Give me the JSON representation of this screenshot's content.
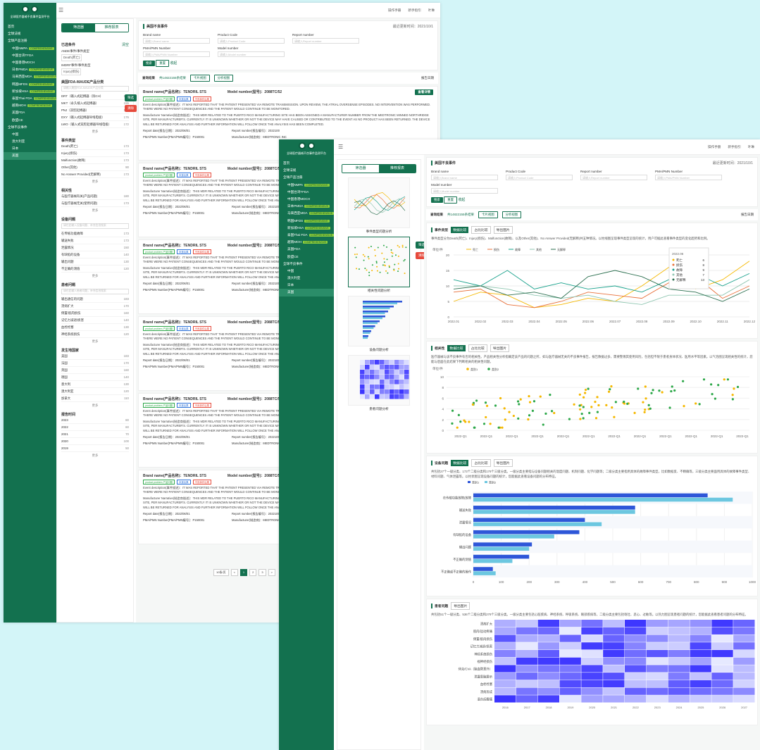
{
  "app": {
    "title": "全球医疗器械不良事件监测平台",
    "menu": [
      "首页",
      "全球法规",
      "全球产品注册",
      "中国NMPA",
      "中国台湾TFDA",
      "中国香港MDCH",
      "日本PMDA",
      "马来西亚MDA",
      "韩国MFDS",
      "新加坡HSA",
      "泰国Thai FDA",
      "越南MOH",
      "美国FDA",
      "欧盟CE",
      "全球不良事件",
      "中国",
      "澳大利亚",
      "日本",
      "美国"
    ],
    "badge": "COMPREHENSIVE"
  },
  "header": {
    "manual": "操作手册",
    "help": "新手指引",
    "user": "叶琳"
  },
  "filter": {
    "tab_list": "筛选器",
    "tab_report": "推荐报表",
    "tab_chart": "筛选器",
    "tab_chart2": "推荐报表",
    "selected": "已选条件",
    "clear": "清空",
    "g1": "ANDE事件/事件类型",
    "g1chip": "Death(死亡)",
    "g2": "IMDRF事件/事件类型",
    "g2chip": "Injury(损伤)",
    "fda_title": "美国FDA-MAUDE产品分类",
    "fda_ph": "请输入美国FDA-MAUDE产品分类",
    "fda_rows": [
      [
        "DRT（输入式起搏器（除CH）",
        173
      ],
      [
        "MKT（永久植入式起搏器）",
        155
      ],
      [
        "PNJ（双腔起搏器）",
        120
      ],
      [
        "DXY（输入式起搏器导线电极）",
        176
      ],
      [
        "LWO（输入式双腔起搏器导线电极）",
        172
      ]
    ],
    "more": "更多",
    "evt_title": "事件类型",
    "evt_rows": [
      [
        "Death(死亡)",
        173
      ],
      [
        "Injury(损伤)",
        173
      ],
      [
        "Malfunction(故障)",
        173
      ],
      [
        "Other(其他)",
        90
      ],
      [
        "No Answer Provided(无解释)",
        173
      ]
    ],
    "rel_title": "相关性",
    "rel_rows": [
      [
        "与医疗器械有关(产品问题)",
        180
      ],
      [
        "与医疗器械无关(使用问题)",
        173
      ]
    ],
    "dev_title": "设备问题",
    "dev_ph": "请在此输入设备问题、补充信息搜索",
    "dev_rows": [
      [
        "在传植功能故障",
        "173"
      ],
      [
        "输送失败",
        173
      ],
      [
        "泄露情况",
        150
      ],
      [
        "有缺陷的设备",
        140
      ],
      [
        "输出问题",
        130
      ],
      [
        "不正确的测值",
        120
      ]
    ],
    "pat_title": "患者问题",
    "pat_ph": "请在此输入患者问题，补充信息搜索",
    "pat_rows": [
      [
        "输出通信的问题",
        183
      ],
      [
        "溃疡扩大",
        170
      ],
      [
        "倒置/肌肉损伤",
        160
      ],
      [
        "记忆力减退/损害",
        140
      ],
      [
        "血栓栓塞",
        130
      ],
      [
        "神经系统损伤",
        120
      ]
    ],
    "area_title": "发生地国家",
    "area_rows": [
      [
        "美国",
        183
      ],
      [
        "法国",
        170
      ],
      [
        "英国",
        160
      ],
      [
        "德国",
        140
      ],
      [
        "意大利",
        130
      ],
      [
        "澳大利亚",
        120
      ],
      [
        "加拿大",
        110
      ]
    ],
    "year_title": "报告时间",
    "year_rows": [
      [
        "2023",
        80
      ],
      [
        "2022",
        60
      ],
      [
        "2021",
        70
      ],
      [
        "2020",
        100
      ],
      [
        "2019",
        50
      ]
    ]
  },
  "search": {
    "title": "美国不良事件",
    "sub": "数据来源：2019年至2023年",
    "updated": "最近更新时间：2021/10/1",
    "f1": "Brand name",
    "f2": "Product Code",
    "f3": "Report number",
    "f4": "PMA/PMN Number",
    "f5": "Model number",
    "ph1": "请输入Brand name",
    "ph2": "请输入Product Code",
    "ph3": "请输入Report number",
    "ph4": "请输入PMA/PMN Number",
    "ph5": "请输入Model number",
    "btn_search": "搜索",
    "btn_reset": "重置",
    "fold": "收起"
  },
  "results": {
    "title": "查询结果",
    "count": "共14822155条结果",
    "tab1": "卡片视图",
    "tab2": "分析视图",
    "sort": "报告日期"
  },
  "event": {
    "brand": "Brand name(产品名称)：TENDRIL STS",
    "model": "Model number(型号)：2088TC/52",
    "detail_btn": "查看详情",
    "t1": "product problem 产品问题",
    "t2": "未遂后果",
    "t3": "不良事件后果",
    "desc": "Event description(事件描述)：IT WAS REPORTED THAT THE PATIENT PRESENTED VIA REMOTE TRANSMISSION. UPON REVIEW, THE ATRIAL OVERSENSE EPISODES. NO INTERVENTION WAS PERFORMED. THERE WERE NO PATIENT CONSEQUENCES AND THE PATIENT WOULD CONTINUE TO BE MONITORED.",
    "narr": "Manufacturer Narrative(制造商描述)：THIS MDR RELATED TO THE PUERTO RICO MANUFACTURING SITE HAS BEEN ASSIGNED A MANUFACTURER NUMBER FROM THE MEDTRONIC MINNED NORTHRIDGE SITE, PER MANUFACTURER'S. CURRENTLY IT IS UNKNOWN WHETHER OR NOT THE DEVICE MAY HAVE CAUSED OR CONTRIBUTED TO THE EVENT AS NO PRODUCT HAS BEEN RETURNED. THE DEVICE WILL BE RETURNED FOR ANALYSIS AND FURTHER INFORMATION WILL FOLLOW ONCE THE ANALYSIS HAS BEEN COMPLETED.",
    "date": "Report date(报告日期)：2022/06/01",
    "rnum": "Report number(报告编号)：2022100",
    "pma": "PMA/PMN Number(PMA/PMN编号)：P150001",
    "mfr": "Manufacturer(制造商)：MEDTRONIC INC"
  },
  "pager": {
    "size": "10条/页",
    "prev": "<",
    "p1": "1",
    "p2": "2",
    "p3": "3",
    "next": ">"
  },
  "float": {
    "filter": "筛选",
    "clear": "清除"
  },
  "reports": {
    "r1": "事件类型问题分析",
    "r2": "相关性问题分析",
    "r3": "设备问题分析",
    "r4": "患者问题分析"
  },
  "analysis": {
    "evt_title": "事件类型",
    "tab_data": "数据比较",
    "tab_ratio": "占比比较",
    "export": "导出图片",
    "evt_desc": "事件类型分为Death(死亡)、Injury(损伤)、Malfunction(故障)、以及Other(其他)、No Answer Provided(无解释)共五种情况。以柱线图呈现事件类型呈现的统计，用户可据此查看事件类型的变化趋势和比例。",
    "rel_title": "相关性",
    "rel_desc": "医疗器械与该不良事件有否的相关性。产品相关性分析指确定该产品的问题之所，如与医疗器械无关的不良事件报告，报告数据过多，需要警惕其使用风险，包括但不限于患者身体状况、医用水平等因素。以气泡图呈现相关性的统计，您能与后面在此结果下判断相关的相关性问题。",
    "dev_title": "设备问题",
    "dev_desc": "共包括27个一级分类、173个二级分类和179个三级分类。一级分类主要指与设备问题相关的温度问题、机制问题、化学问题等；二级分类主要指用具体的故障事件类型，比如数据反、不精确等，三级分类主要面用具体的故障事件类型、材料问题、气体泄露等。以柱状图呈现设备问题的统计，您能据此查看设备问题的分布特征。",
    "pat_title": "患者问题",
    "pat_desc": "共包括51个一级分类、536个二级分类和279个三级分类。一级分类主要包括心脏疾病、神经系统、呼吸系统、眼部疾病等，二级分类主要包括呕吐、恶心、过敏等。以热力图呈现患者问题的统计，您能据此查看患者问题的分布特征。",
    "tooltip": {
      "date": "2022.06",
      "rows": [
        [
          "死亡",
          6
        ],
        [
          "损伤",
          8
        ],
        [
          "故障",
          9
        ],
        [
          "其他",
          7
        ],
        [
          "无解释",
          13
        ]
      ]
    }
  },
  "chart_data": [
    {
      "type": "line",
      "title": "事件类型",
      "ylabel": "单位/件",
      "x": [
        "2022.01",
        "2022.02",
        "2022.03",
        "2022.04",
        "2022.05",
        "2022.06",
        "2022.07",
        "2022.08",
        "2022.09",
        "2022.10",
        "2022.11",
        "2022.12"
      ],
      "ylim": [
        0,
        20
      ],
      "series": [
        {
          "name": "死亡",
          "color": "#f5b800",
          "values": [
            5,
            8,
            7,
            3,
            4,
            6,
            5,
            10,
            16,
            9,
            12,
            18
          ]
        },
        {
          "name": "损伤",
          "color": "#e8703a",
          "values": [
            8,
            9,
            4,
            3,
            5,
            8,
            7,
            6,
            11,
            13,
            6,
            10
          ]
        },
        {
          "name": "故障",
          "color": "#16a08a",
          "values": [
            12,
            10,
            15,
            9,
            11,
            9,
            10,
            8,
            12,
            14,
            10,
            14
          ]
        },
        {
          "name": "其他",
          "color": "#8fc6b1",
          "values": [
            10,
            10,
            9,
            7,
            6,
            7,
            5,
            4,
            7,
            7,
            7,
            12
          ]
        },
        {
          "name": "无解释",
          "color": "#2b6f4f",
          "values": [
            9,
            10,
            7,
            8,
            6,
            13,
            15,
            13,
            9,
            8,
            5,
            9
          ]
        }
      ]
    },
    {
      "type": "scatter",
      "title": "相关性",
      "ylabel": "单位/件",
      "x": [
        "2022-Q1",
        "2022-Q1",
        "2022-Q1",
        "2022-Q1",
        "2022-Q1",
        "2022-Q1",
        "2022-Q1",
        "2022-Q1",
        "2022-Q1",
        "2022-Q1",
        "2022-Q1",
        "2022-Q1"
      ],
      "ylim": [
        0,
        10
      ],
      "series": [
        {
          "name": "类别1",
          "color": "#f5b800"
        },
        {
          "name": "类别2",
          "color": "#2ea84a"
        }
      ]
    },
    {
      "type": "bar",
      "title": "设备问题",
      "xlim": [
        0,
        1000
      ],
      "categories": [
        "在传植功能故障(故障器件生产的不良事件)",
        "输送失败",
        "泄露情况",
        "有缺陷的设备",
        "输出问题",
        "不正确的测值",
        "不正确或不正确的操作或系统"
      ],
      "series": [
        {
          "name": "类别1",
          "color": "#2e56d8",
          "values": [
            840,
            580,
            400,
            380,
            210,
            200,
            70
          ]
        },
        {
          "name": "类别2",
          "color": "#6cc7e0",
          "values": [
            930,
            580,
            460,
            290,
            200,
            140,
            80
          ]
        }
      ]
    },
    {
      "type": "heatmap",
      "title": "患者问题",
      "rows": [
        "溃疡扩大",
        "肌肉/运动疼痛",
        "倒置/肌肉损伤",
        "记忆力减退/损害",
        "神经系统损伤",
        "视神经损伤",
        "休克/CVA（脑血管意外）",
        "泄露患脑震示",
        "血栓栓塞",
        "溃疡形成",
        "混合后腹痛"
      ],
      "columns": [
        "2016",
        "2017",
        "2018",
        "2019",
        "2020",
        "2021",
        "2022",
        "2023",
        "2024",
        "2025",
        "2026",
        "2027"
      ]
    }
  ]
}
